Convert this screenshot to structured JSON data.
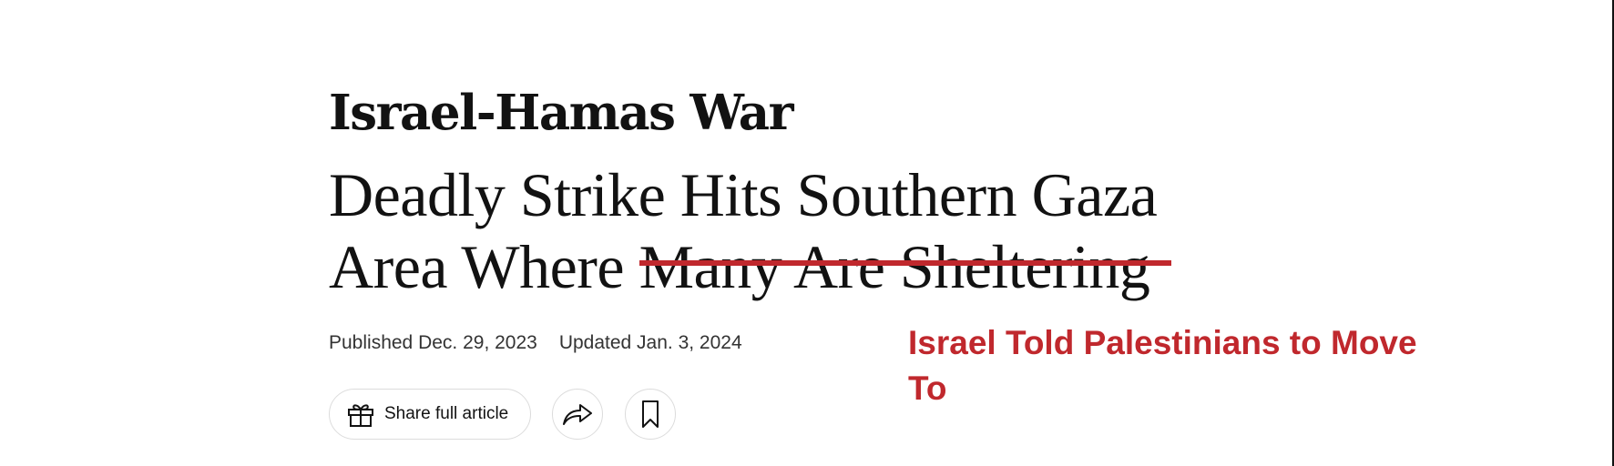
{
  "article": {
    "kicker": "Israel-Hamas War",
    "headline_line1": "Deadly Strike Hits Southern Gaza",
    "headline_line2_prefix": "Area Where ",
    "headline_struck": "Many Are Sheltering",
    "published": "Published Dec. 29, 2023",
    "updated": "Updated Jan. 3, 2024",
    "correction": "Israel Told Palestinians to Move To"
  },
  "toolbar": {
    "share_full_label": "Share full article",
    "gift_icon": "gift-icon",
    "share_icon": "share-arrow-icon",
    "bookmark_icon": "bookmark-icon"
  },
  "colors": {
    "text": "#121212",
    "strike": "#c0282d",
    "correction": "#c0282d",
    "meta": "#333333",
    "button_border": "#dcdcdc"
  }
}
